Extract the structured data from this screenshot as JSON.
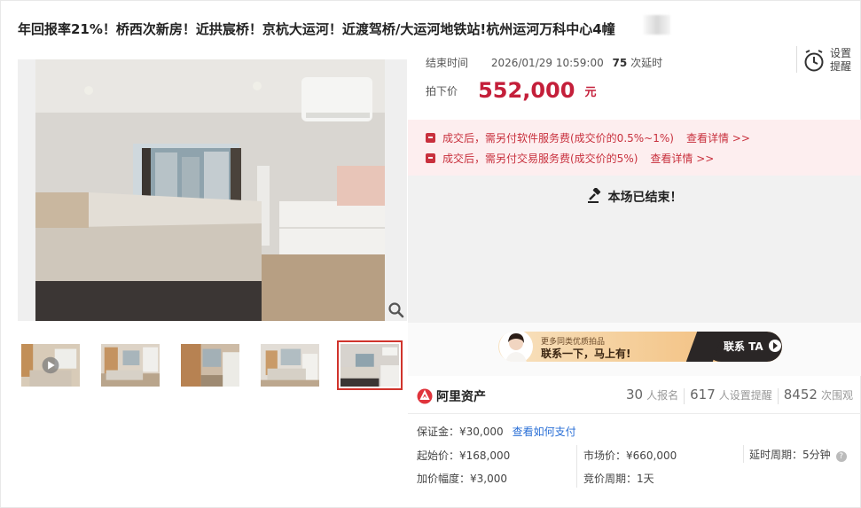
{
  "title": "年回报率21%！桥西次新房！近拱宸桥！京杭大运河！近渡驾桥/大运河地铁站!杭州运河万科中心4幢",
  "auction": {
    "end_label": "结束时间",
    "end_time": "2026/01/29 10:59:00",
    "delay_count": "75",
    "delay_suffix": "次延时",
    "price_label": "拍下价",
    "price": "552,000",
    "price_unit": "元",
    "ended_text": "本场已结束！"
  },
  "reminder": {
    "line1": "设置",
    "line2": "提醒"
  },
  "fees": [
    {
      "text": "成交后，需另付软件服务费(成交价的0.5%~1%)",
      "link": "查看详情 >>"
    },
    {
      "text": "成交后，需另付交易服务费(成交价的5%)",
      "link": "查看详情 >>"
    }
  ],
  "banner": {
    "small": "更多同类优质拍品",
    "big": "联系一下，马上有!",
    "button": "联系 TA"
  },
  "brand": {
    "name": "阿里资产"
  },
  "stats": [
    {
      "num": "30",
      "label": "人报名"
    },
    {
      "num": "617",
      "label": "人设置提醒"
    },
    {
      "num": "8452",
      "label": "次围观"
    }
  ],
  "info": {
    "deposit_label": "保证金：¥30,000",
    "deposit_link": "查看如何支付",
    "start_price": "起始价：¥168,000",
    "market_price": "市场价：¥660,000",
    "delay_period": "延时周期：5分钟",
    "increment": "加价幅度：¥3,000",
    "bid_period": "竞价周期：1天"
  },
  "colors": {
    "price": "#c41f3a",
    "fee_bg": "#fdeeef",
    "link": "#2a6fd6",
    "active_thumb": "#d0342c"
  }
}
